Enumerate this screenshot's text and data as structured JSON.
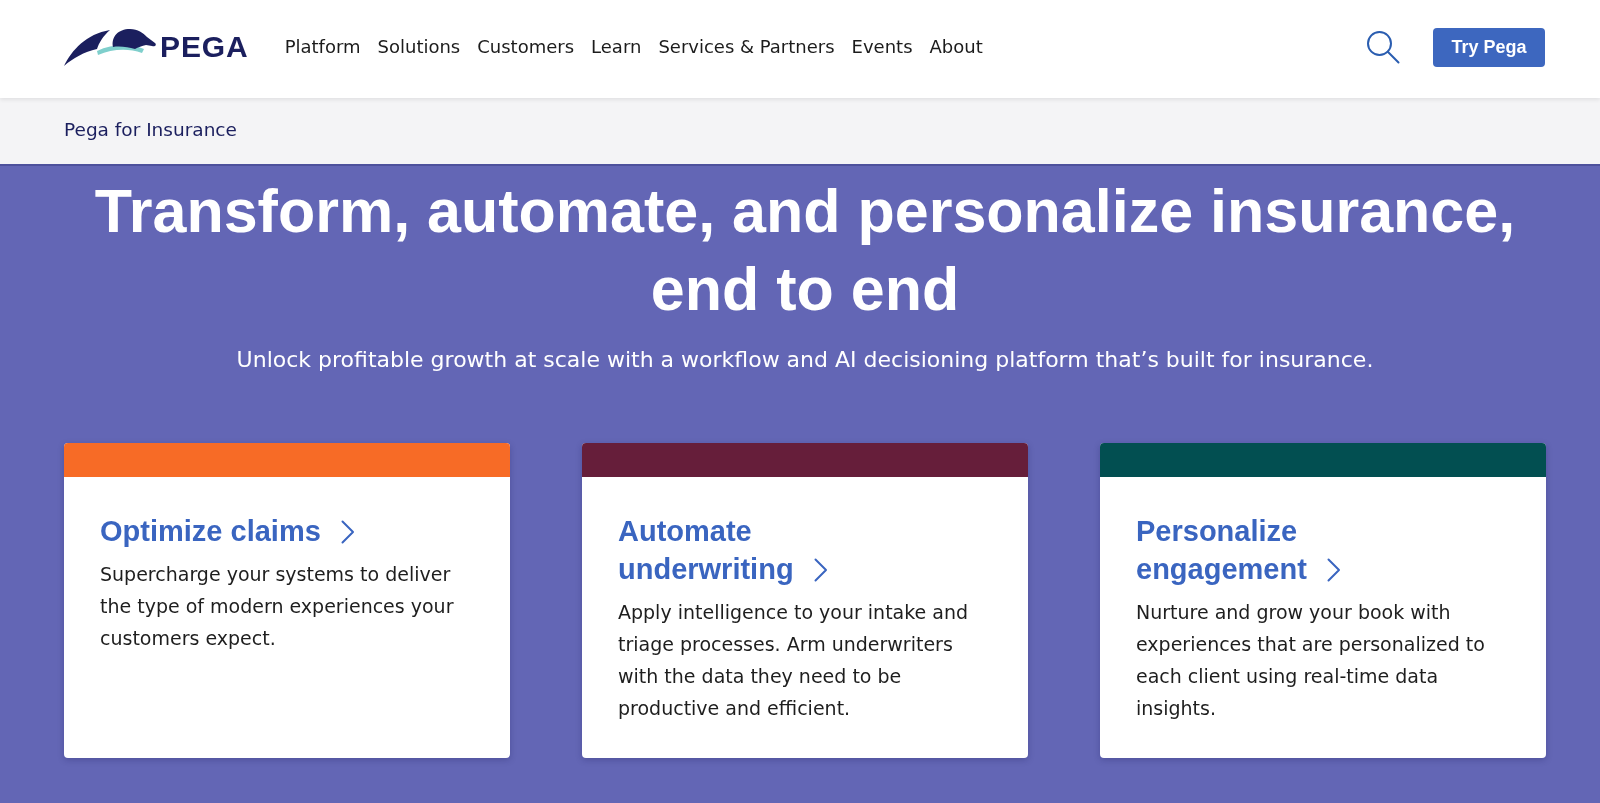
{
  "header": {
    "logo": {
      "text": "PEGA"
    },
    "nav": [
      "Platform",
      "Solutions",
      "Customers",
      "Learn",
      "Services & Partners",
      "Events",
      "About"
    ],
    "cta": "Try Pega"
  },
  "breadcrumb": {
    "label": "Pega for Insurance"
  },
  "hero": {
    "title": "Transform, automate, and personalize insurance, end to end",
    "subtitle": "Unlock profitable growth at scale with a workflow and AI decisioning platform that’s built for insurance."
  },
  "cards": [
    {
      "title": "Optimize claims",
      "color": "#f76b26",
      "text": "Supercharge your systems to deliver the type of modern experiences your customers expect."
    },
    {
      "title": "Automate underwriting",
      "color": "#661e3a",
      "text": "Apply intelligence to your intake and triage processes. Arm underwriters with the data they need to be productive and efficient."
    },
    {
      "title": "Personalize engagement",
      "color": "#024f51",
      "text": "Nurture and grow your book with experiences that are personalized to each client using real-time data insights."
    }
  ]
}
